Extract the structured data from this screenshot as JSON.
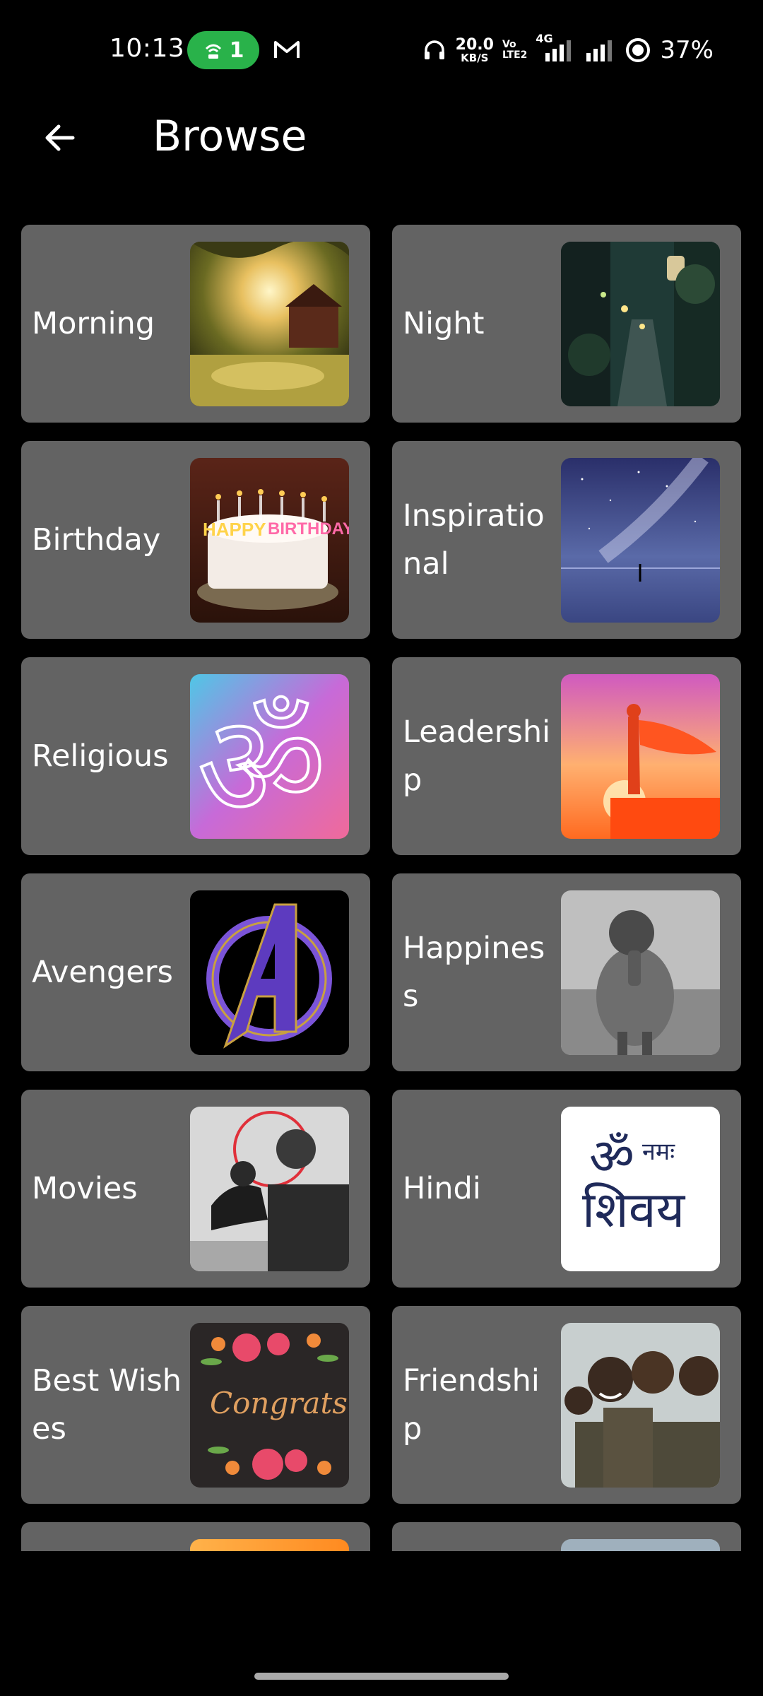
{
  "status_bar": {
    "time": "10:13",
    "hotspot_count": "1",
    "net_speed_value": "20.0",
    "net_speed_unit": "KB/S",
    "volte_line1": "Vo",
    "volte_line2": "LTE2",
    "network_type": "4G",
    "battery": "37%"
  },
  "app_bar": {
    "title": "Browse",
    "back_icon": "arrow-left-icon"
  },
  "categories": [
    {
      "label": "Morning",
      "theme": "sunrise-forest"
    },
    {
      "label": "Night",
      "theme": "night-alley"
    },
    {
      "label": "Birthday",
      "theme": "birthday-cake"
    },
    {
      "label": "Inspirational",
      "theme": "milky-way"
    },
    {
      "label": "Religious",
      "theme": "om-symbol"
    },
    {
      "label": "Leadership",
      "theme": "caped-figure"
    },
    {
      "label": "Avengers",
      "theme": "avengers-logo"
    },
    {
      "label": "Happiness",
      "theme": "child-praying"
    },
    {
      "label": "Movies",
      "theme": "man-with-dog"
    },
    {
      "label": "Hindi",
      "theme": "om-namah-shivay"
    },
    {
      "label": "Best Wishes",
      "theme": "congrats-flowers"
    },
    {
      "label": "Friendship",
      "theme": "smiling-children"
    },
    {
      "label": "",
      "theme": "orange-partial"
    },
    {
      "label": "",
      "theme": "grey-partial"
    }
  ],
  "colors": {
    "background": "#000000",
    "card": "#636363",
    "hotspot_pill": "#29b24a"
  }
}
